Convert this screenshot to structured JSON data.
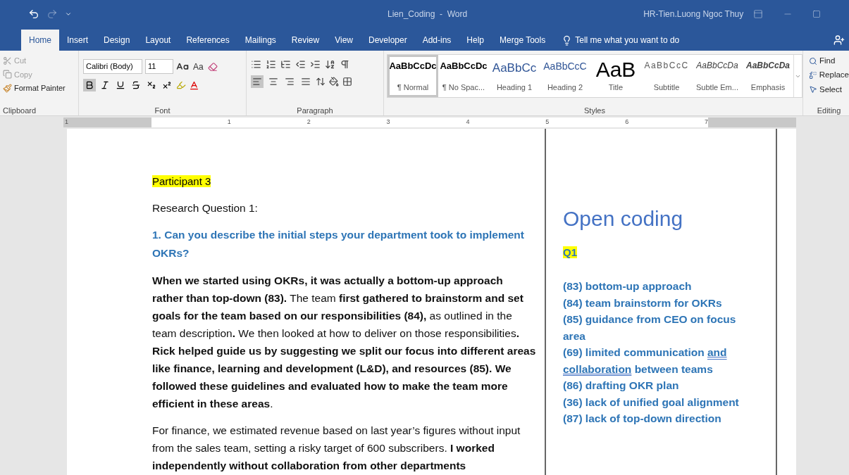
{
  "window": {
    "title": "Lien_Coding  -  Word",
    "user": "HR-Tien.Luong Ngoc Thuy"
  },
  "quick_access": [
    {
      "kind": "undo",
      "disabled": false
    },
    {
      "kind": "redo",
      "disabled": true
    },
    {
      "kind": "customize",
      "disabled": false
    }
  ],
  "tabs": [
    {
      "label": "Home",
      "selected": true
    },
    {
      "label": "Insert",
      "selected": false
    },
    {
      "label": "Design",
      "selected": false
    },
    {
      "label": "Layout",
      "selected": false
    },
    {
      "label": "References",
      "selected": false
    },
    {
      "label": "Mailings",
      "selected": false
    },
    {
      "label": "Review",
      "selected": false
    },
    {
      "label": "View",
      "selected": false
    },
    {
      "label": "Developer",
      "selected": false
    },
    {
      "label": "Add-ins",
      "selected": false
    },
    {
      "label": "Help",
      "selected": false
    },
    {
      "label": "Merge Tools",
      "selected": false
    }
  ],
  "tell_me": {
    "placeholder": "Tell me what you want to do"
  },
  "clipboard": {
    "label": "Clipboard",
    "items": [
      {
        "kind": "cut",
        "label": "Cut",
        "disabled": true
      },
      {
        "kind": "copy",
        "label": "Copy",
        "disabled": true
      },
      {
        "kind": "painter",
        "label": "Format Painter",
        "disabled": false
      }
    ]
  },
  "font": {
    "label": "Font",
    "font_name": "Calibri (Body)",
    "font_size": "11",
    "change_case": "Aa",
    "format_buttons": [
      {
        "kind": "bold",
        "selected": true
      },
      {
        "kind": "italic",
        "selected": false
      },
      {
        "kind": "underline",
        "selected": false
      },
      {
        "kind": "strike",
        "selected": false
      },
      {
        "kind": "subscript",
        "selected": false
      },
      {
        "kind": "superscript",
        "selected": false
      }
    ]
  },
  "paragraph": {
    "label": "Paragraph",
    "alignments": [
      {
        "kind": "left",
        "selected": true
      },
      {
        "kind": "center",
        "selected": false
      },
      {
        "kind": "right",
        "selected": false
      },
      {
        "kind": "justify",
        "selected": false
      }
    ]
  },
  "styles": {
    "label": "Styles",
    "items": [
      {
        "preview": "AaBbCcDc",
        "name": "¶ Normal",
        "kind": "normal",
        "selected": true
      },
      {
        "preview": "AaBbCcDc",
        "name": "¶ No Spac...",
        "kind": "nospace",
        "selected": false
      },
      {
        "preview": "AaBbCc",
        "name": "Heading 1",
        "kind": "h1",
        "selected": false
      },
      {
        "preview": "AaBbCcC",
        "name": "Heading 2",
        "kind": "h2",
        "selected": false
      },
      {
        "preview": "AaB",
        "name": "Title",
        "kind": "title",
        "selected": false
      },
      {
        "preview": "AaBbCcC",
        "name": "Subtitle",
        "kind": "subtitle",
        "selected": false
      },
      {
        "preview": "AaBbCcDa",
        "name": "Subtle Em...",
        "kind": "subtle",
        "selected": false
      },
      {
        "preview": "AaBbCcDa",
        "name": "Emphasis",
        "kind": "emphasis",
        "selected": false
      }
    ]
  },
  "editing": {
    "label": "Editing",
    "items": [
      {
        "kind": "find",
        "label": "Find"
      },
      {
        "kind": "replace",
        "label": "Replace"
      },
      {
        "kind": "select",
        "label": "Select"
      }
    ]
  },
  "ruler": [
    "1",
    "1",
    "2",
    "3",
    "4",
    "5",
    "6",
    "7"
  ],
  "document": {
    "paragraphs": [
      {
        "kind": "highlight",
        "text": "Participant 3"
      },
      {
        "kind": "plain",
        "text": "Research Question 1:"
      },
      {
        "kind": "question",
        "text": "1. Can you describe the initial steps your department took to implement OKRs?"
      },
      {
        "kind": "plain",
        "text": "**When we started using OKRs, it was actually a bottom-up approach rather than top-down (83).** The team **first gathered to brainstorm and set goals for the team based on our responsibilities (84),** as outlined in the team description**.** We then looked at how to deliver on those responsibilities**. Rick helped guide us by suggesting we split our focus into different areas like finance, learning and development (L&D), and resources (85). We followed these guidelines and evaluated how to make the team more efficient in these areas**."
      },
      {
        "kind": "plain",
        "text": "For finance, we estimated revenue based on last year’s figures without input from the sales team, setting a risky target of 600 subscribers. **I worked independently without collaboration from other departments**"
      }
    ]
  },
  "text_box": {
    "title": "Open coding",
    "label": "Q1",
    "codes": [
      {
        "parts": [
          {
            "text": "(83) bottom-up approach",
            "underlined": false
          }
        ]
      },
      {
        "parts": [
          {
            "text": "(84) team brainstorm for OKRs",
            "underlined": false
          }
        ]
      },
      {
        "parts": [
          {
            "text": "(85) guidance from CEO on focus area",
            "underlined": false
          }
        ]
      },
      {
        "parts": [
          {
            "text": "(69) limited communication ",
            "underlined": false
          },
          {
            "text": "and collaboration",
            "underlined": true
          },
          {
            "text": " between teams",
            "underlined": false
          }
        ]
      },
      {
        "parts": [
          {
            "text": "(86) drafting OKR plan",
            "underlined": false
          }
        ]
      },
      {
        "parts": [
          {
            "text": "(36) lack of unified goal alignment",
            "underlined": false
          }
        ]
      },
      {
        "parts": [
          {
            "text": "(87) lack of top-down direction",
            "underlined": false
          }
        ]
      }
    ]
  }
}
